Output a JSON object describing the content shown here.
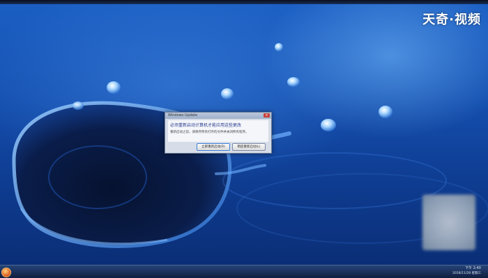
{
  "watermark": {
    "text": "天奇·视频"
  },
  "dialog": {
    "title": "Windows Update",
    "close_icon": "close-icon",
    "heading": "必须重新启动计算机才能应用这些更改",
    "message": "重新启动之前，请保存所有打开的文件并关闭所有程序。",
    "restart_now_label": "立即重新启动(R)",
    "restart_later_label": "稍后重新启动(L)"
  },
  "taskbar": {
    "start_icon": "windows-orb-icon",
    "clock_time": "下午 2:40",
    "clock_date": "2018/11/28 星期三"
  },
  "colors": {
    "desktop_blue": "#1550b0",
    "dialog_heading": "#2a3b8f",
    "accent_button_border": "#3c7fd6"
  }
}
